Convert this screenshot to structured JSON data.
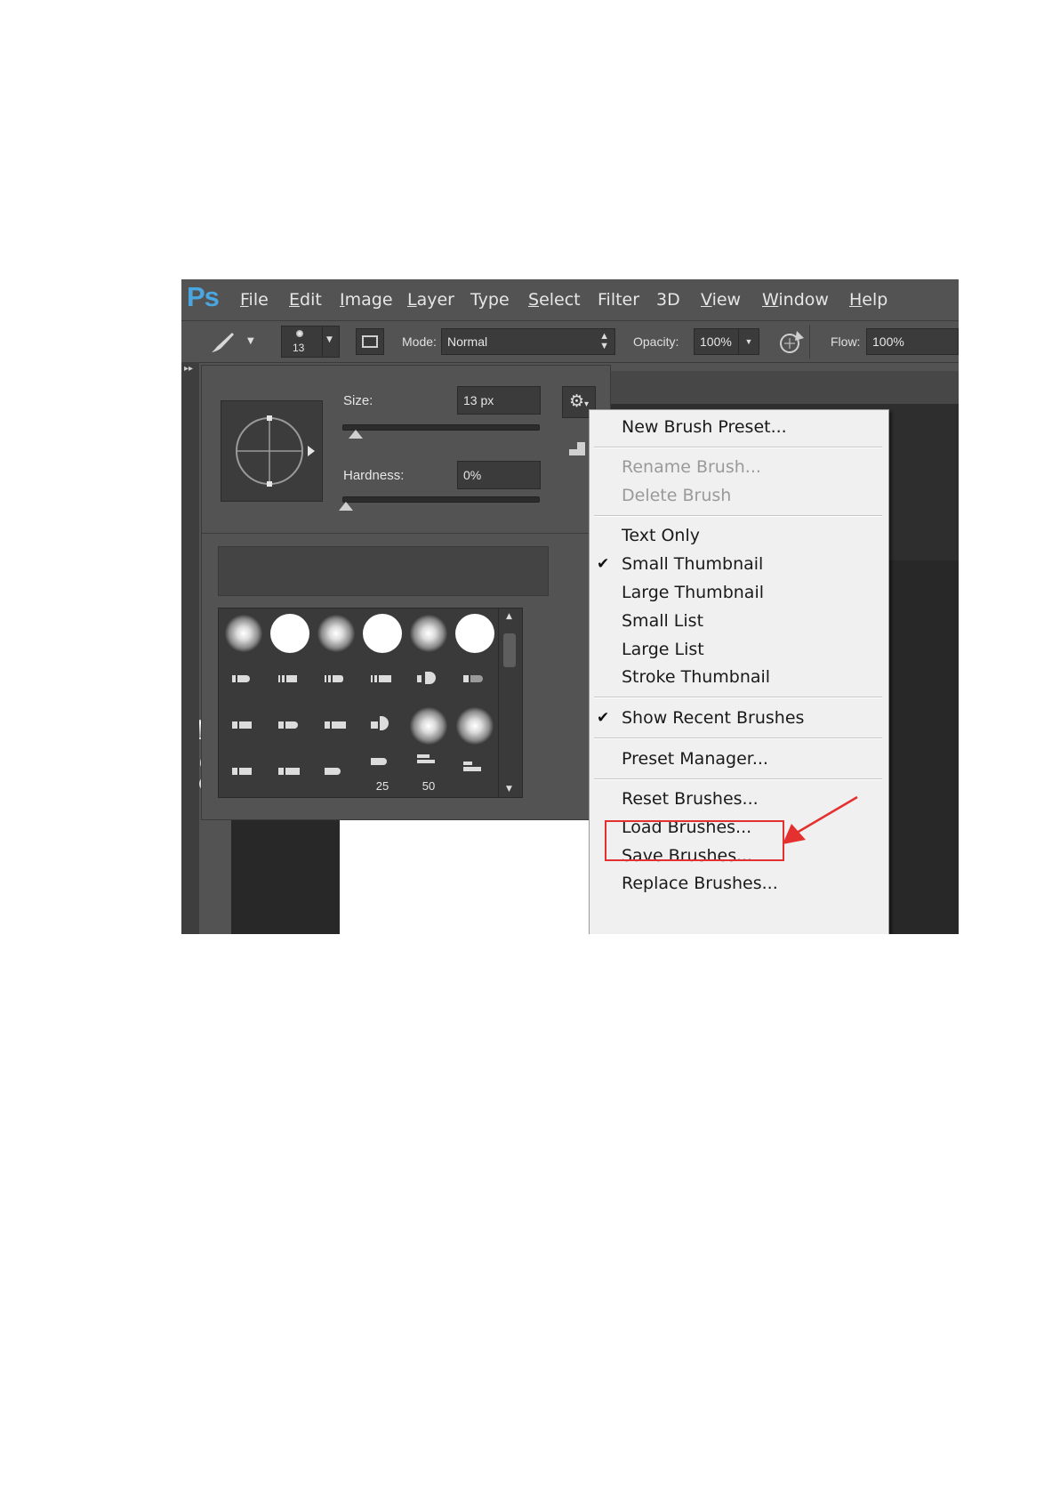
{
  "app": {
    "logo": "Ps"
  },
  "menubar": {
    "items": [
      {
        "label": "File",
        "u": "F",
        "rest": "ile"
      },
      {
        "label": "Edit",
        "u": "E",
        "rest": "dit"
      },
      {
        "label": "Image",
        "u": "I",
        "rest": "mage"
      },
      {
        "label": "Layer",
        "u": "L",
        "rest": "ayer"
      },
      {
        "label": "Type",
        "u": "",
        "rest": "Type"
      },
      {
        "label": "Select",
        "u": "S",
        "rest": "elect"
      },
      {
        "label": "Filter",
        "u": "",
        "rest": "Filter"
      },
      {
        "label": "3D",
        "u": "",
        "rest": "3D"
      },
      {
        "label": "View",
        "u": "V",
        "rest": "iew"
      },
      {
        "label": "Window",
        "u": "W",
        "rest": "indow"
      },
      {
        "label": "Help",
        "u": "H",
        "rest": "elp"
      }
    ]
  },
  "options": {
    "brush_size": "13",
    "mode_label": "Mode:",
    "mode_value": "Normal",
    "opacity_label": "Opacity:",
    "opacity_value": "100%",
    "flow_label": "Flow:",
    "flow_value": "100%"
  },
  "brush_panel": {
    "size_label": "Size:",
    "size_value": "13 px",
    "size_level": 0.05,
    "hardness_label": "Hardness:",
    "hardness_value": "0%",
    "hardness_level": 0.0,
    "preset_numbers": [
      "25",
      "50"
    ]
  },
  "context_menu": {
    "items": [
      {
        "label": "New Brush Preset...",
        "disabled": false,
        "checked": false
      },
      {
        "label": "Rename Brush...",
        "disabled": true,
        "checked": false
      },
      {
        "label": "Delete Brush",
        "disabled": true,
        "checked": false
      },
      {
        "label": "Text Only",
        "disabled": false,
        "checked": false
      },
      {
        "label": "Small Thumbnail",
        "disabled": false,
        "checked": true
      },
      {
        "label": "Large Thumbnail",
        "disabled": false,
        "checked": false
      },
      {
        "label": "Small List",
        "disabled": false,
        "checked": false
      },
      {
        "label": "Large List",
        "disabled": false,
        "checked": false
      },
      {
        "label": "Stroke Thumbnail",
        "disabled": false,
        "checked": false
      },
      {
        "label": "Show Recent Brushes",
        "disabled": false,
        "checked": true
      },
      {
        "label": "Preset Manager...",
        "disabled": false,
        "checked": false
      },
      {
        "label": "Reset Brushes...",
        "disabled": false,
        "checked": false,
        "highlighted": true
      },
      {
        "label": "Load Brushes...",
        "disabled": false,
        "checked": false
      },
      {
        "label": "Save Brushes...",
        "disabled": false,
        "checked": false
      },
      {
        "label": "Replace Brushes...",
        "disabled": false,
        "checked": false
      }
    ]
  },
  "colors": {
    "annotation": "#e53030",
    "ps_blue": "#4aa6e0"
  }
}
